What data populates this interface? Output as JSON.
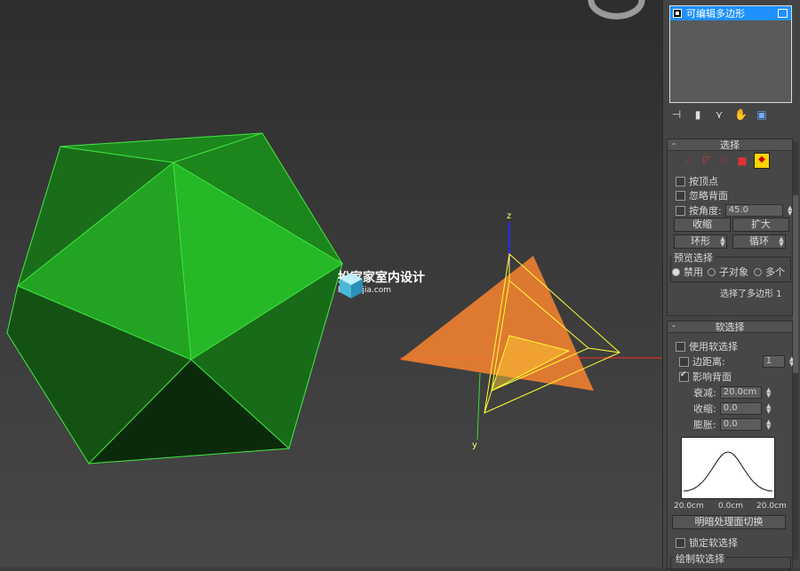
{
  "watermark": {
    "title": "扮家家室内设计",
    "url": "banjiajia.com"
  },
  "gizmo": {
    "z_label": "z",
    "y_label": "y"
  },
  "modifier_stack": {
    "item_label": "可编辑多边形"
  },
  "selection": {
    "title": "选择",
    "by_vertex": "按顶点",
    "ignore_backface": "忽略背面",
    "by_angle": "按角度:",
    "angle_value": "45.0",
    "shrink": "收缩",
    "grow": "扩大",
    "ring": "环形",
    "loop": "循环",
    "preview_title": "预览选择",
    "preview_off": "禁用",
    "preview_sub": "子对象",
    "preview_multi": "多个",
    "status": "选择了多边形 1"
  },
  "soft_selection": {
    "title": "软选择",
    "use_soft": "使用软选择",
    "edge_distance": "边距离:",
    "edge_value": "1",
    "affect_backface": "影响背面",
    "falloff": "衰减:",
    "falloff_value": "20.0cm",
    "pinch": "收缩:",
    "pinch_value": "0.0",
    "bubble": "膨胀:",
    "bubble_value": "0.0",
    "curve_left": "20.0cm",
    "curve_mid": "0.0cm",
    "curve_right": "20.0cm",
    "shaded_face_toggle": "明暗处理面切换",
    "lock_soft": "锁定软选择",
    "paint_title": "绘制软选择"
  },
  "colors": {
    "accent": "#1e90ff",
    "ico_green": "#1f8c1f",
    "tri_orange": "#f08030",
    "active_yellow": "#ffd400"
  }
}
